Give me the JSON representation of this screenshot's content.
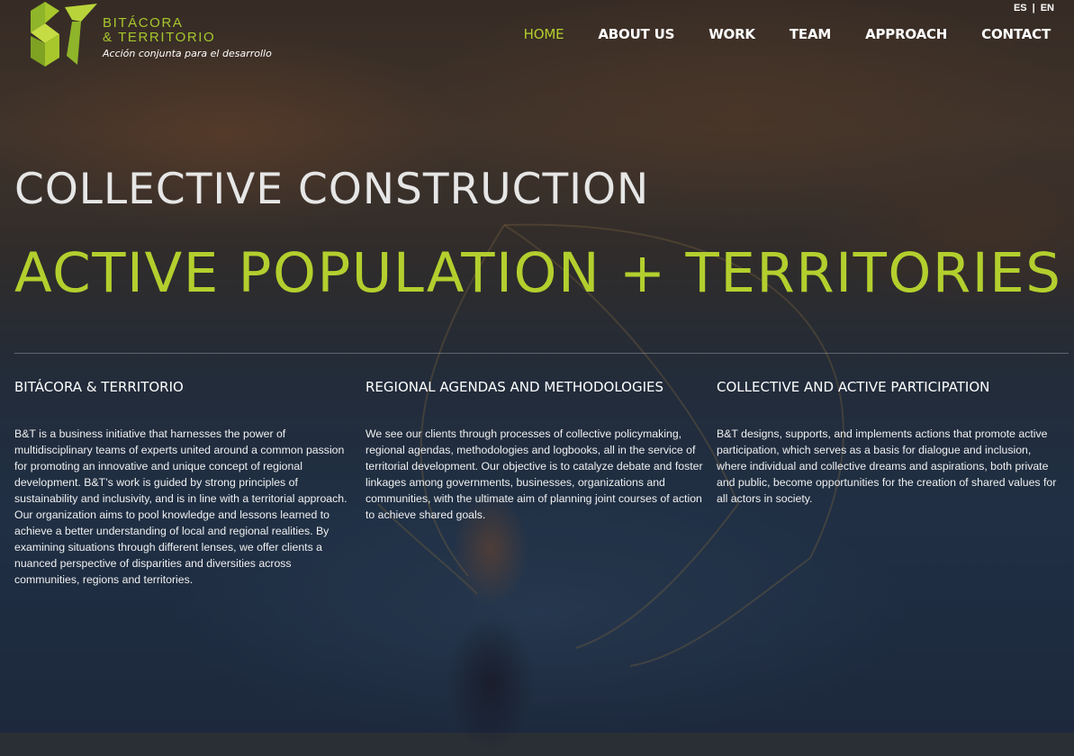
{
  "brand": {
    "name_line1": "BITÁCORA",
    "name_line2": "& TERRITORIO",
    "tagline": "Acción conjunta para el desarrollo",
    "color": "#a7c72c"
  },
  "languages": {
    "es": "ES",
    "separator": "|",
    "en": "EN"
  },
  "nav": {
    "items": [
      {
        "label": "HOME",
        "active": true
      },
      {
        "label": "ABOUT US",
        "active": false
      },
      {
        "label": "WORK",
        "active": false
      },
      {
        "label": "TEAM",
        "active": false
      },
      {
        "label": "APPROACH",
        "active": false
      },
      {
        "label": "CONTACT",
        "active": false
      }
    ]
  },
  "hero": {
    "line1": "COLLECTIVE CONSTRUCTION",
    "line2": "ACTIVE POPULATION + TERRITORIES"
  },
  "columns": [
    {
      "title": "BITÁCORA & TERRITORIO",
      "body": "B&T is a business initiative that harnesses the power of multidisciplinary teams of experts united around a common passion for promoting an innovative and unique concept of regional development. B&T’s work is guided by strong principles of sustainability and inclusivity, and is in line with a territorial approach. Our organization aims to pool knowledge and lessons learned to achieve a better understanding of local and regional realities. By examining situations through different lenses, we offer clients a nuanced perspective of disparities and diversities across communities, regions and territories."
    },
    {
      "title": "REGIONAL AGENDAS AND METHODOLOGIES",
      "body": "We see our clients through processes of collective policymaking, regional agendas, methodologies and logbooks, all in the service of territorial development. Our objective is to catalyze debate and foster linkages among governments, businesses, organizations and communities, with the ultimate aim of planning joint courses of action to achieve shared goals."
    },
    {
      "title": "COLLECTIVE AND ACTIVE PARTICIPATION",
      "body": "B&T designs, supports, and implements actions that promote active participation, which serves as a basis for dialogue and inclusion, where individual and collective dreams and aspirations, both private and public, become opportunities for the creation of shared values for all actors in society."
    }
  ],
  "colors": {
    "accent": "#b3cf2e",
    "text": "#ffffff"
  }
}
